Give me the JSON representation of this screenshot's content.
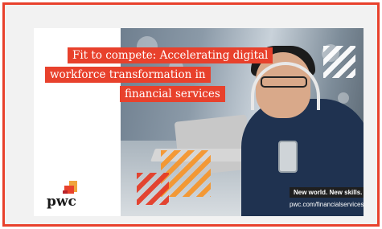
{
  "ad": {
    "headline_lines": [
      "Fit to compete: Accelerating digital",
      "workforce transformation in",
      "financial services"
    ],
    "logo_text": "pwc",
    "tagline": "New world. New skills.",
    "url": "pwc.com/financialservices",
    "colors": {
      "border": "#e8412c",
      "headline_bg": "#e8412c",
      "logo_orange": "#f0a43b",
      "logo_red": "#e8412c",
      "tagline_bg": "#1f1f1f"
    }
  }
}
